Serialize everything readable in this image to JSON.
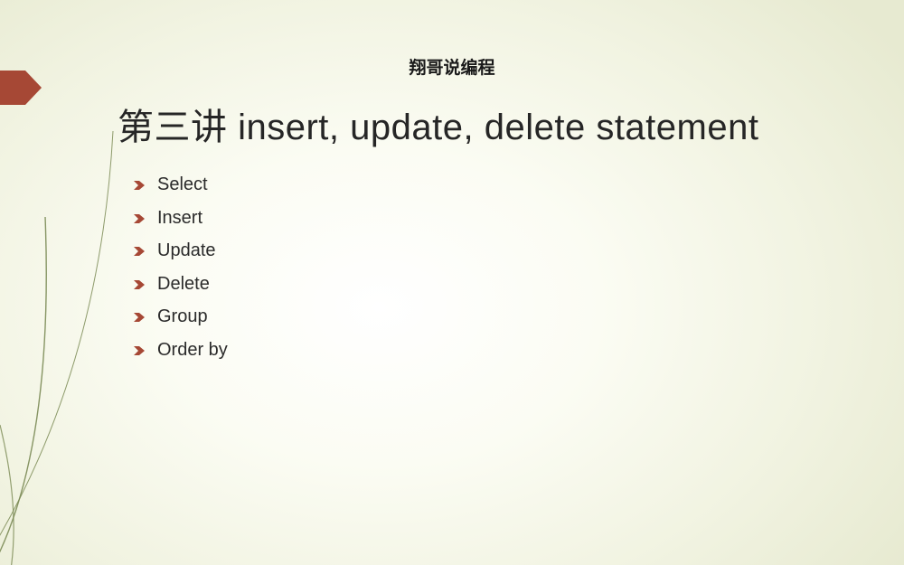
{
  "header": {
    "label": "翔哥说编程"
  },
  "title": "第三讲 insert, update, delete statement",
  "bullets": [
    "Select",
    "Insert",
    "Update",
    "Delete",
    "Group",
    "Order by"
  ],
  "accent_color": "#a64835",
  "curve_color": "#7a8a54"
}
